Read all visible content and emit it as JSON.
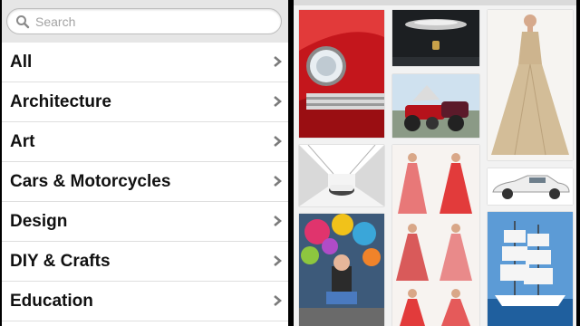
{
  "search": {
    "placeholder": "Search"
  },
  "categories": [
    {
      "label": "All"
    },
    {
      "label": "Architecture"
    },
    {
      "label": "Art"
    },
    {
      "label": "Cars & Motorcycles"
    },
    {
      "label": "Design"
    },
    {
      "label": "DIY & Crafts"
    },
    {
      "label": "Education"
    }
  ],
  "grid": {
    "pins": [
      {
        "name": "red-car-pin",
        "subject": "red vintage car headlight"
      },
      {
        "name": "car-top-pin",
        "subject": "silver car roof on dark background"
      },
      {
        "name": "motorcycle-pin",
        "subject": "red motorcycle with trike"
      },
      {
        "name": "gold-dress-pin",
        "subject": "gold beaded gown"
      },
      {
        "name": "tunnel-car-pin",
        "subject": "car in white tunnel"
      },
      {
        "name": "pink-dresses-pin",
        "subject": "pink and red gowns"
      },
      {
        "name": "white-car-pin",
        "subject": "white BMW sedan"
      },
      {
        "name": "colorful-art-pin",
        "subject": "colorful figure with feathers"
      },
      {
        "name": "sailing-ship-pin",
        "subject": "tall sailing ship"
      }
    ]
  },
  "icons": {
    "search": "search-icon",
    "chevron": "chevron-right-icon"
  }
}
